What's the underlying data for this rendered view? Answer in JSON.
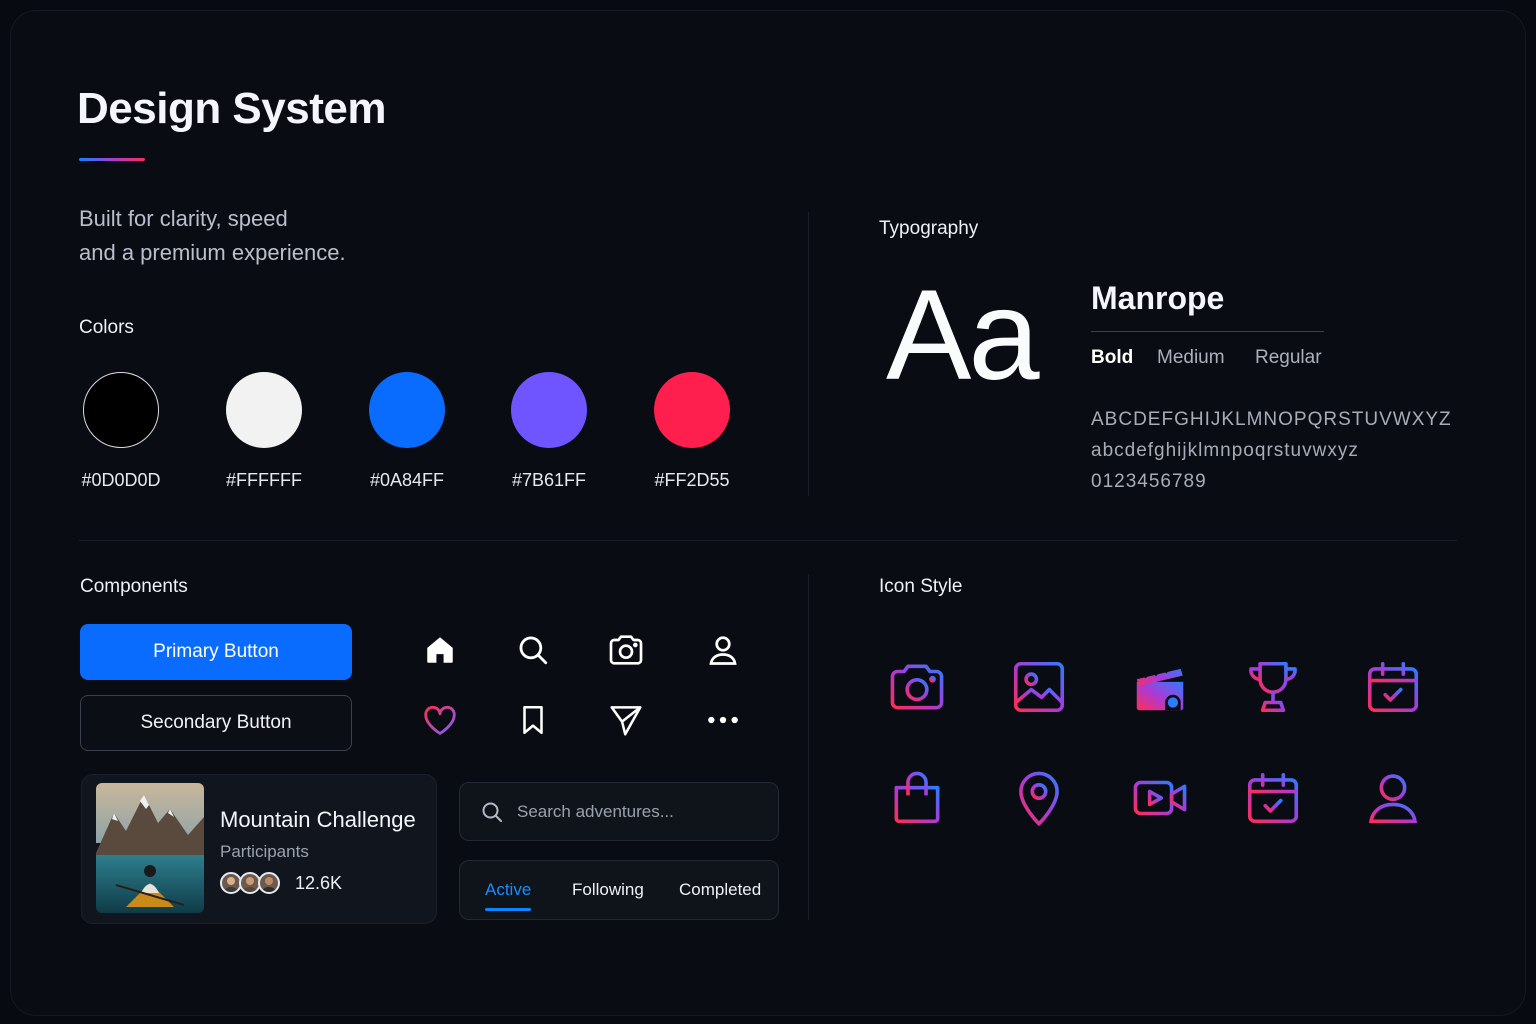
{
  "header": {
    "title": "Design System",
    "tagline_line1": "Built for clarity, speed",
    "tagline_line2": "and a premium experience."
  },
  "colors": {
    "label": "Colors",
    "swatches": [
      {
        "hex": "#0D0D0D",
        "label": "#0D0D0D"
      },
      {
        "hex": "#FFFFFF",
        "label": "#FFFFFF"
      },
      {
        "hex": "#0A84FF",
        "label": "#0A84FF"
      },
      {
        "hex": "#7B61FF",
        "label": "#7B61FF"
      },
      {
        "hex": "#FF2D55",
        "label": "#FF2D55"
      }
    ]
  },
  "typography": {
    "label": "Typography",
    "sample": "Aa",
    "font_name": "Manrope",
    "weights": [
      "Bold",
      "Medium",
      "Regular"
    ],
    "uppercase": "ABCDEFGHIJKLMNOPQRSTUVWXYZ",
    "lowercase": "abcdefghijklmnpoqrstuvwxyz",
    "digits": "0123456789"
  },
  "components": {
    "label": "Components",
    "primary_button": "Primary Button",
    "secondary_button": "Secondary Button",
    "icons_row1": [
      "home-icon",
      "search-icon",
      "camera-icon",
      "user-icon"
    ],
    "icons_row2": [
      "heart-icon",
      "bookmark-icon",
      "send-icon",
      "more-icon"
    ],
    "card": {
      "title": "Mountain Challenge",
      "subtitle": "Participants",
      "count": "12.6K"
    },
    "search": {
      "placeholder": "Search adventures..."
    },
    "tabs": [
      "Active",
      "Following",
      "Completed"
    ]
  },
  "icon_style": {
    "label": "Icon Style",
    "icons": [
      "camera-icon",
      "image-icon",
      "clapperboard-icon",
      "trophy-icon",
      "calendar-check-icon",
      "shopping-bag-icon",
      "location-pin-icon",
      "video-icon",
      "calendar-check-icon",
      "user-icon"
    ],
    "gradient_start": "#FF2D55",
    "gradient_end": "#0A84FF"
  }
}
